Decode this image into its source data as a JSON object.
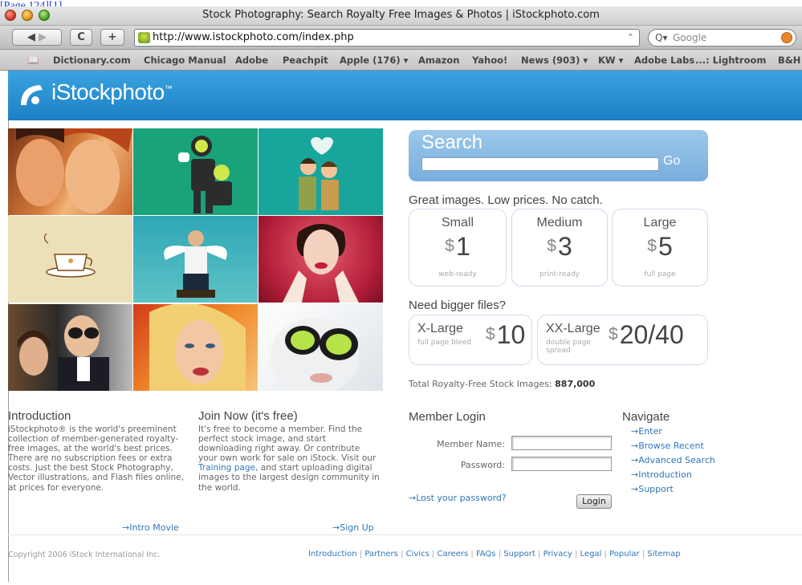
{
  "page_link": "[Page 124][1]",
  "window": {
    "title": "Stock Photography: Search Royalty Free Images & Photos | iStockphoto.com"
  },
  "toolbar": {
    "back": "◀",
    "forward": "▶",
    "reload": "C",
    "add": "+",
    "url": "http://www.istockphoto.com/index.php",
    "search_placeholder": "Google"
  },
  "bookmarks": [
    "Dictionary.com",
    "Chicago Manual",
    "Adobe",
    "Peachpit",
    "Apple (176) ▾",
    "Amazon",
    "Yahoo!",
    "News (903) ▾",
    "KW ▾",
    "Adobe Labs",
    "...: Lightroom",
    "B&H"
  ],
  "site": {
    "logo_text": "iStockphoto",
    "logo_tm": "™"
  },
  "search": {
    "title": "Search",
    "go": "Go"
  },
  "tagline": "Great images. Low prices. No catch.",
  "pricing": [
    {
      "size": "Small",
      "currency": "$",
      "price": "1",
      "note": "web-ready"
    },
    {
      "size": "Medium",
      "currency": "$",
      "price": "3",
      "note": "print-ready"
    },
    {
      "size": "Large",
      "currency": "$",
      "price": "5",
      "note": "full page"
    }
  ],
  "bigger": {
    "heading": "Need bigger files?",
    "items": [
      {
        "size": "X-Large",
        "note": "full page bleed",
        "currency": "$",
        "price": "10"
      },
      {
        "size": "XX-Large",
        "note": "double page spread",
        "currency": "$",
        "price": "20/40"
      }
    ]
  },
  "total": {
    "label": "Total Royalty-Free Stock Images:",
    "value": "887,000"
  },
  "intro": {
    "title": "Introduction",
    "body": "iStockphoto® is the world's preeminent collection of member-generated royalty-free images, at the world's best prices. There are no subscription fees or extra costs. Just the best Stock Photography, Vector illustrations, and Flash files online, at prices for everyone.",
    "link": "→Intro Movie"
  },
  "join": {
    "title": "Join Now (it's free)",
    "body_1": "It's free to become a member. Find the perfect stock image, and start downloading right away. Or contribute your own work for sale on iStock. Visit our",
    "body_link": "Training page,",
    "body_2": "and start uploading digital images to the largest design community in the world.",
    "link": "→Sign Up"
  },
  "login": {
    "title": "Member Login",
    "name_label": "Member Name:",
    "password_label": "Password:",
    "lost_link": "→Lost your password?",
    "button": "Login"
  },
  "navigate": {
    "title": "Navigate",
    "items": [
      "→Enter",
      "→Browse Recent",
      "→Advanced Search",
      "→Introduction",
      "→Support"
    ]
  },
  "footer": {
    "copyright": "Copyright 2006 iStock International Inc.",
    "links": [
      "Introduction",
      "Partners",
      "Civics",
      "Careers",
      "FAQs",
      "Support",
      "Privacy",
      "Legal",
      "Popular",
      "Sitemap"
    ]
  },
  "colors": {
    "brand_blue": "#2a8fd3",
    "search_blue": "#8bbde5",
    "link": "#2f76b8"
  }
}
